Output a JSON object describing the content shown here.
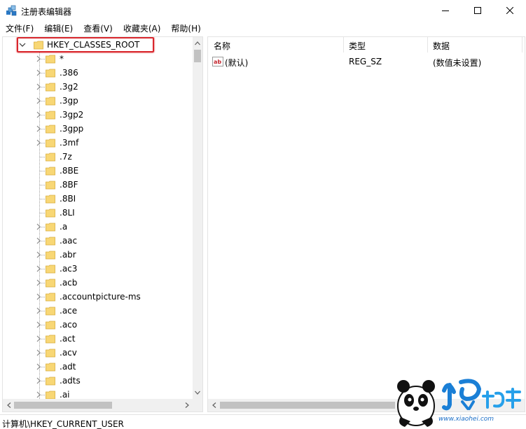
{
  "window": {
    "title": "注册表编辑器",
    "icon": "regedit-icon",
    "controls": {
      "minimize": "minimize-icon",
      "maximize": "maximize-icon",
      "close": "close-icon"
    }
  },
  "menu": {
    "items": [
      {
        "label": "文件(F)"
      },
      {
        "label": "编辑(E)"
      },
      {
        "label": "查看(V)"
      },
      {
        "label": "收藏夹(A)"
      },
      {
        "label": "帮助(H)"
      }
    ]
  },
  "tree": {
    "root": {
      "label": "HKEY_CLASSES_ROOT",
      "expanded": true,
      "highlight_color": "#d9262c"
    },
    "children": [
      {
        "label": "*",
        "expandable": true
      },
      {
        "label": ".386",
        "expandable": true
      },
      {
        "label": ".3g2",
        "expandable": true
      },
      {
        "label": ".3gp",
        "expandable": true
      },
      {
        "label": ".3gp2",
        "expandable": true
      },
      {
        "label": ".3gpp",
        "expandable": true
      },
      {
        "label": ".3mf",
        "expandable": true
      },
      {
        "label": ".7z",
        "expandable": false
      },
      {
        "label": ".8BE",
        "expandable": false
      },
      {
        "label": ".8BF",
        "expandable": false
      },
      {
        "label": ".8BI",
        "expandable": false
      },
      {
        "label": ".8LI",
        "expandable": false
      },
      {
        "label": ".a",
        "expandable": true
      },
      {
        "label": ".aac",
        "expandable": true
      },
      {
        "label": ".abr",
        "expandable": true
      },
      {
        "label": ".ac3",
        "expandable": true
      },
      {
        "label": ".acb",
        "expandable": true
      },
      {
        "label": ".accountpicture-ms",
        "expandable": true
      },
      {
        "label": ".ace",
        "expandable": true
      },
      {
        "label": ".aco",
        "expandable": true
      },
      {
        "label": ".act",
        "expandable": true
      },
      {
        "label": ".acv",
        "expandable": true
      },
      {
        "label": ".adt",
        "expandable": true
      },
      {
        "label": ".adts",
        "expandable": true
      },
      {
        "label": ".ai",
        "expandable": true
      }
    ]
  },
  "list": {
    "columns": [
      {
        "label": "名称"
      },
      {
        "label": "类型"
      },
      {
        "label": "数据"
      }
    ],
    "rows": [
      {
        "icon": "reg-string-icon",
        "icon_text": "ab",
        "name": "(默认)",
        "type": "REG_SZ",
        "data": "(数值未设置)"
      }
    ]
  },
  "status": {
    "path": "计算机\\HKEY_CURRENT_USER"
  },
  "watermark": {
    "site": "www.xiaohei.com",
    "logo": "panda-mascot-icon"
  }
}
